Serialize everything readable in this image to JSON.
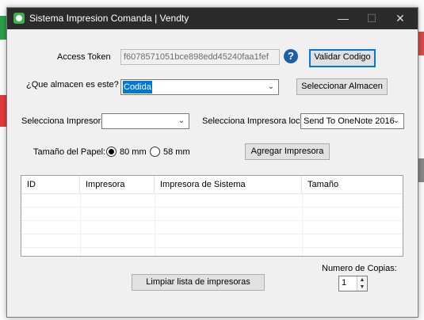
{
  "window": {
    "title": "Sistema Impresion Comanda | Vendty"
  },
  "access_token": {
    "label": "Access Token",
    "value": "f6078571051bce898edd45240faa1fef"
  },
  "validate_button": "Validar Codigo",
  "help_icon_text": "?",
  "warehouse": {
    "label": "¿Que almacen es este?",
    "selected": "Codida",
    "button": "Seleccionar Almacen"
  },
  "printer": {
    "label": "Selecciona Impresora",
    "selected": ""
  },
  "local_printer": {
    "label": "Selecciona Impresora local",
    "selected": "Send To OneNote 2016"
  },
  "paper": {
    "label": "Tamaño del Papel:",
    "options": [
      "80 mm",
      "58 mm"
    ],
    "selected": "80 mm"
  },
  "add_printer_button": "Agregar Impresora",
  "table": {
    "columns": [
      "ID",
      "Impresora",
      "Impresora de Sistema",
      "Tamaño"
    ],
    "rows": []
  },
  "clear_button": "Limpiar lista de impresoras",
  "copies": {
    "label": "Numero de Copias:",
    "value": "1"
  },
  "icons": {
    "minimize": "minimize-icon",
    "maximize": "maximize-icon",
    "close": "close-icon"
  }
}
